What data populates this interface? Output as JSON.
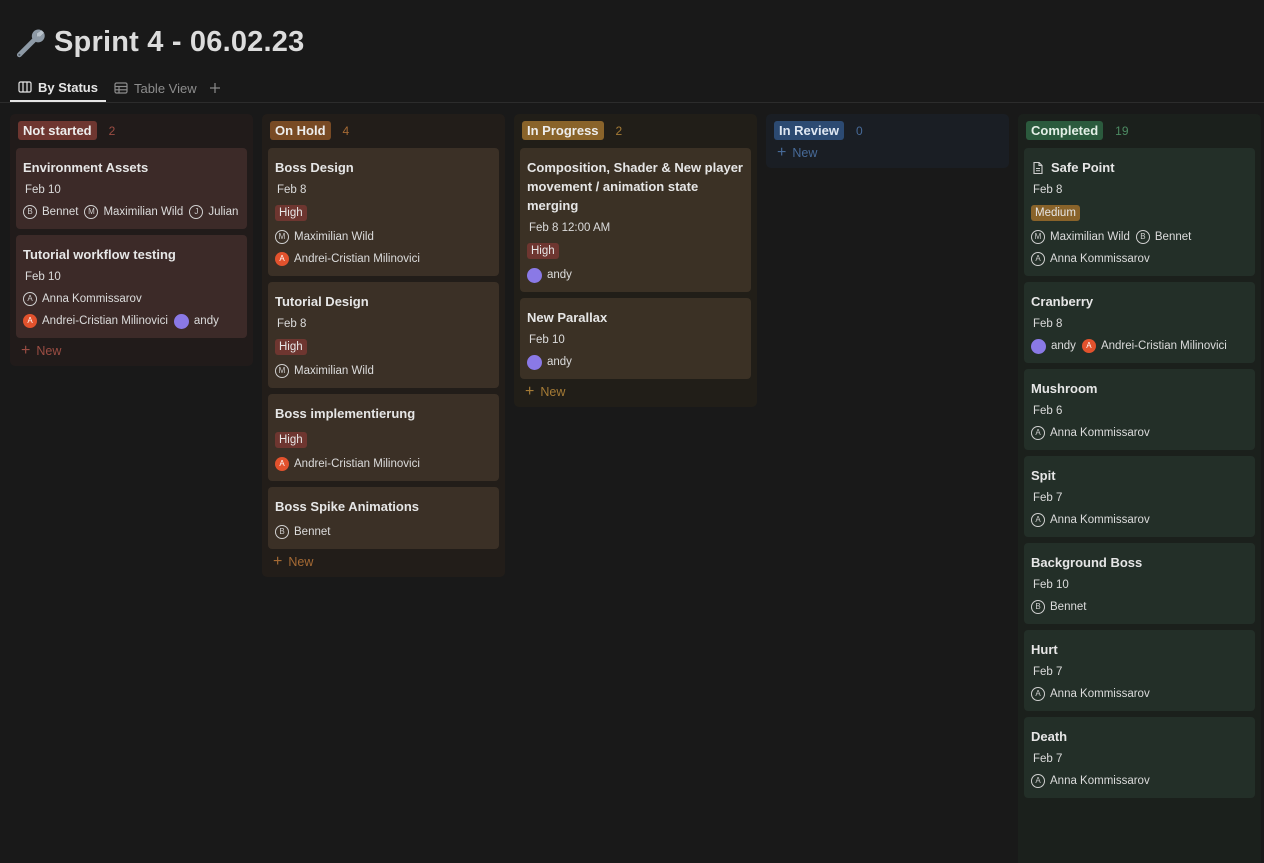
{
  "page": {
    "title": "Sprint 4 - 06.02.23",
    "title_icon": "wrench-icon"
  },
  "tabs": [
    {
      "label": "By Status",
      "icon": "board-icon",
      "active": true
    },
    {
      "label": "Table View",
      "icon": "table-icon",
      "active": false
    }
  ],
  "add_view_label": "+",
  "new_label": "New",
  "columns": [
    {
      "name": "Not started",
      "count": "2",
      "color": "#6e3630",
      "cards": [
        {
          "title": "Environment Assets",
          "date": "Feb 10",
          "people": [
            "Bennet",
            "Maximilian Wild",
            "Julian"
          ]
        },
        {
          "title": "Tutorial workflow testing",
          "date": "Feb 10",
          "people": [
            "Anna Kommissarov",
            "Andrei-Cristian Milinovici",
            "andy"
          ]
        }
      ]
    },
    {
      "name": "On Hold",
      "count": "4",
      "color": "#784a24",
      "cards": [
        {
          "title": "Boss Design",
          "date": "Feb 8",
          "priority": "High",
          "people": [
            "Maximilian Wild",
            "Andrei-Cristian Milinovici"
          ]
        },
        {
          "title": "Tutorial Design",
          "date": "Feb 8",
          "priority": "High",
          "people": [
            "Maximilian Wild"
          ]
        },
        {
          "title": "Boss implementierung",
          "priority": "High",
          "people": [
            "Andrei-Cristian Milinovici"
          ]
        },
        {
          "title": "Boss Spike Animations",
          "people": [
            "Bennet"
          ]
        }
      ]
    },
    {
      "name": "In Progress",
      "count": "2",
      "color": "#89632a",
      "cards": [
        {
          "title": "Composition, Shader & New player movement / animation state merging",
          "date": "Feb 8 12:00 AM",
          "priority": "High",
          "people": [
            "andy"
          ]
        },
        {
          "title": "New Parallax",
          "date": "Feb 10",
          "people": [
            "andy"
          ]
        }
      ]
    },
    {
      "name": "In Review",
      "count": "0",
      "color": "#2c4a72",
      "cards": []
    },
    {
      "name": "Completed",
      "count": "19",
      "color": "#2b5a3d",
      "cards": [
        {
          "title": "Safe Point",
          "date": "Feb 8",
          "priority": "Medium",
          "people": [
            "Maximilian Wild",
            "Bennet",
            "Anna Kommissarov"
          ],
          "icon": "document-icon"
        },
        {
          "title": "Cranberry",
          "date": "Feb 8",
          "people": [
            "andy",
            "Andrei-Cristian Milinovici"
          ]
        },
        {
          "title": "Mushroom",
          "date": "Feb 6",
          "people": [
            "Anna Kommissarov"
          ]
        },
        {
          "title": "Spit",
          "date": "Feb 7",
          "people": [
            "Anna Kommissarov"
          ]
        },
        {
          "title": "Background Boss",
          "date": "Feb 10",
          "people": [
            "Bennet"
          ]
        },
        {
          "title": "Hurt",
          "date": "Feb 7",
          "people": [
            "Anna Kommissarov"
          ]
        },
        {
          "title": "Death",
          "date": "Feb 7",
          "people": [
            "Anna Kommissarov"
          ]
        }
      ]
    }
  ],
  "avatars": {
    "Bennet": {
      "initial": "B",
      "style": "outline"
    },
    "Maximilian Wild": {
      "initial": "M",
      "style": "outline"
    },
    "Julian": {
      "initial": "J",
      "style": "outline"
    },
    "Anna Kommissarov": {
      "initial": "A",
      "style": "outline"
    },
    "Andrei-Cristian Milinovici": {
      "initial": "A",
      "style": "orange",
      "color": "#e2522d"
    },
    "andy": {
      "initial": "",
      "style": "purple",
      "color": "#8a79e6"
    }
  }
}
